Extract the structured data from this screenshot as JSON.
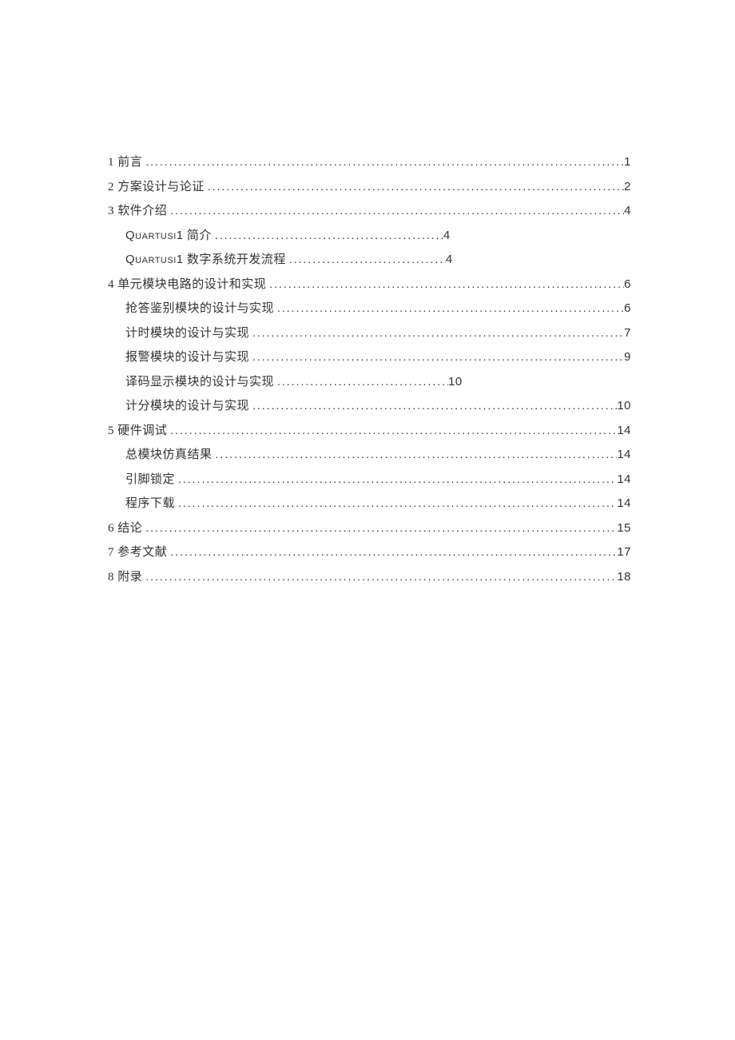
{
  "toc": {
    "entries": [
      {
        "level": 1,
        "title": "1 前言",
        "page": "1",
        "full": true
      },
      {
        "level": 1,
        "title": "2 方案设计与论证",
        "page": "2",
        "full": true
      },
      {
        "level": 1,
        "title": "3 软件介绍",
        "page": "4",
        "full": true
      },
      {
        "level": 2,
        "title_sc": "Quartusi1",
        "title_rest": " 简介",
        "page": "4",
        "full": false,
        "leader": "a"
      },
      {
        "level": 2,
        "title_sc": "Quartusi1",
        "title_rest": " 数字系统开发流程",
        "page": "4",
        "full": false,
        "leader": "b"
      },
      {
        "level": 1,
        "title": "4 单元模块电路的设计和实现",
        "page": "6",
        "full": true
      },
      {
        "level": 2,
        "title": "抢答鉴别模块的设计与实现",
        "page": "6",
        "full": true
      },
      {
        "level": 2,
        "title": "计时模块的设计与实现",
        "page": "7",
        "full": true
      },
      {
        "level": 2,
        "title": "报警模块的设计与实现",
        "page": "9",
        "full": true
      },
      {
        "level": 2,
        "title": "译码显示模块的设计与实现",
        "page": "10",
        "full": false,
        "leader": "c"
      },
      {
        "level": 2,
        "title": "计分模块的设计与实现",
        "page": "10",
        "full": true
      },
      {
        "level": 1,
        "title": "5 硬件调试",
        "page": "14",
        "full": true
      },
      {
        "level": 2,
        "title": "总模块仿真结果",
        "page": "14",
        "full": true
      },
      {
        "level": 2,
        "title": "引脚锁定",
        "page": "14",
        "full": true
      },
      {
        "level": 2,
        "title": "程序下载",
        "page": "14",
        "full": true
      },
      {
        "level": 1,
        "title": "6 结论",
        "page": "15",
        "full": true
      },
      {
        "level": 1,
        "title": "7 参考文献",
        "page": "17",
        "full": true
      },
      {
        "level": 1,
        "title": "8 附录",
        "page": "18",
        "full": true
      }
    ]
  }
}
